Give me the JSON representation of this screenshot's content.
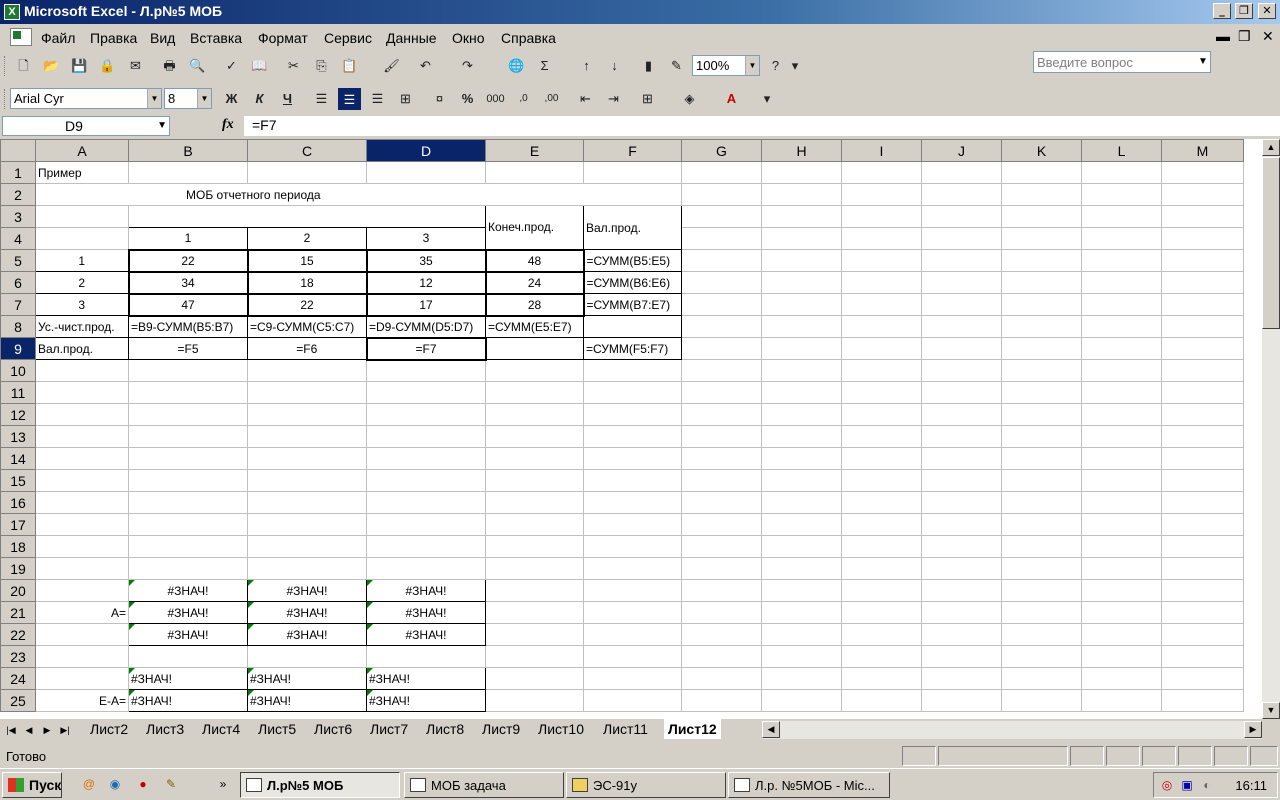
{
  "window": {
    "title": "Microsoft Excel - Л.р№5 МОБ"
  },
  "menu": [
    "Файл",
    "Правка",
    "Вид",
    "Вставка",
    "Формат",
    "Сервис",
    "Данные",
    "Окно",
    "Справка"
  ],
  "ask_placeholder": "Введите вопрос",
  "toolbar": {
    "zoom": "100%",
    "font": "Arial Cyr",
    "font_size": "8"
  },
  "formula_bar": {
    "name_box": "D9",
    "fx": "fx",
    "formula": "=F7"
  },
  "columns": [
    "A",
    "B",
    "C",
    "D",
    "E",
    "F",
    "G",
    "H",
    "I",
    "J",
    "K",
    "L",
    "M"
  ],
  "active_column": "D",
  "active_row": "9",
  "rows": [
    {
      "n": "1",
      "a": "Пример"
    },
    {
      "n": "2",
      "title": "МОБ отчетного периода"
    },
    {
      "n": "3",
      "e": "Конеч.прод.",
      "f": "Вал.прод."
    },
    {
      "n": "4",
      "b": "1",
      "c": "2",
      "d": "3"
    },
    {
      "n": "5",
      "a": "1",
      "b": "22",
      "c": "15",
      "d": "35",
      "e": "48",
      "f": "=СУММ(B5:E5)"
    },
    {
      "n": "6",
      "a": "2",
      "b": "34",
      "c": "18",
      "d": "12",
      "e": "24",
      "f": "=СУММ(B6:E6)"
    },
    {
      "n": "7",
      "a": "3",
      "b": "47",
      "c": "22",
      "d": "17",
      "e": "28",
      "f": "=СУММ(B7:E7)"
    },
    {
      "n": "8",
      "a": "Ус.-чист.прод.",
      "b": "=B9-СУММ(B5:B7)",
      "c": "=C9-СУММ(C5:C7)",
      "d": "=D9-СУММ(D5:D7)",
      "e": "=СУММ(E5:E7)"
    },
    {
      "n": "9",
      "a": "Вал.прод.",
      "b": "=F5",
      "c": "=F6",
      "d": "=F7",
      "f": "=СУММ(F5:F7)"
    },
    {
      "n": "10"
    },
    {
      "n": "11"
    },
    {
      "n": "12"
    },
    {
      "n": "13"
    },
    {
      "n": "14"
    },
    {
      "n": "15"
    },
    {
      "n": "16"
    },
    {
      "n": "17"
    },
    {
      "n": "18"
    },
    {
      "n": "19"
    },
    {
      "n": "20",
      "b": "#ЗНАЧ!",
      "c": "#ЗНАЧ!",
      "d": "#ЗНАЧ!"
    },
    {
      "n": "21",
      "a": "A=",
      "b": "#ЗНАЧ!",
      "c": "#ЗНАЧ!",
      "d": "#ЗНАЧ!"
    },
    {
      "n": "22",
      "b": "#ЗНАЧ!",
      "c": "#ЗНАЧ!",
      "d": "#ЗНАЧ!"
    },
    {
      "n": "23"
    },
    {
      "n": "24",
      "b": "#ЗНАЧ!",
      "c": "#ЗНАЧ!",
      "d": "#ЗНАЧ!"
    },
    {
      "n": "25",
      "a": "E-A=",
      "b": "#ЗНАЧ!",
      "c": "#ЗНАЧ!",
      "d": "#ЗНАЧ!"
    }
  ],
  "sheet_tabs": [
    "Лист2",
    "Лист3",
    "Лист4",
    "Лист5",
    "Лист6",
    "Лист7",
    "Лист8",
    "Лист9",
    "Лист10",
    "Лист11",
    "Лист12"
  ],
  "active_tab": "Лист12",
  "status": "Готово",
  "taskbar": {
    "start": "Пуск",
    "tasks": [
      "Л.р№5 МОБ",
      "МОБ задача",
      "ЭС-91у",
      "Л.р. №5МОБ - Mic..."
    ],
    "clock": "16:11"
  }
}
